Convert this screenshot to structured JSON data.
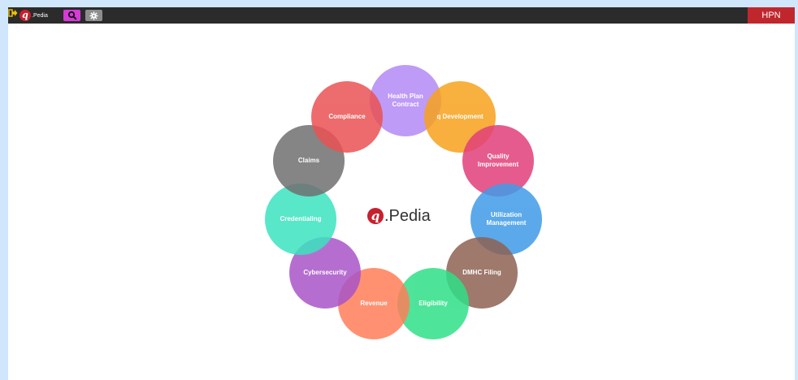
{
  "topbar": {
    "brand_text": ".Pedia",
    "brand_mark": "q",
    "search_icon": "search-icon",
    "settings_icon": "gear-icon",
    "logout_icon": "logout-icon",
    "hpn_label": "HPN"
  },
  "center": {
    "mark": "q",
    "text": ".Pedia"
  },
  "circles": [
    {
      "label": "Health Plan Contract",
      "color": "#b38af5"
    },
    {
      "label": "q Development",
      "color": "#f7a21c"
    },
    {
      "label": "Quality Improvement",
      "color": "#e23f7a"
    },
    {
      "label": "Utilization Management",
      "color": "#3f9be8"
    },
    {
      "label": "DMHC Filing",
      "color": "#8e6253"
    },
    {
      "label": "Eligibility",
      "color": "#2fe088"
    },
    {
      "label": "Revenue",
      "color": "#ff7e59"
    },
    {
      "label": "Cybersecurity",
      "color": "#a955c8"
    },
    {
      "label": "Credentialing",
      "color": "#3be3bf"
    },
    {
      "label": "Claims",
      "color": "#707070"
    },
    {
      "label": "Compliance",
      "color": "#ea5253"
    }
  ]
}
